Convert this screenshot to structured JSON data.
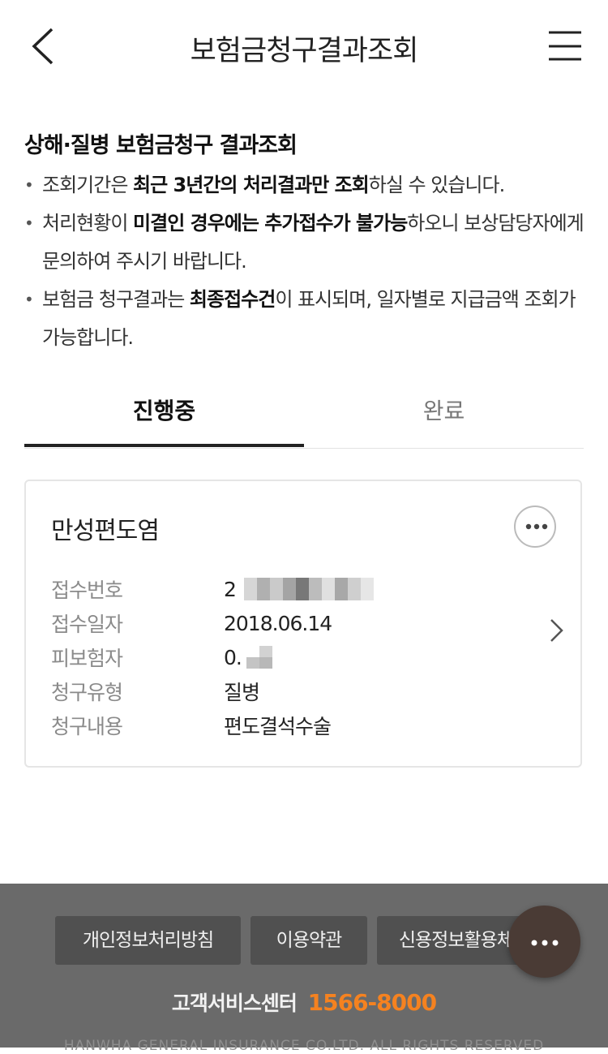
{
  "header": {
    "title": "보험금청구결과조회",
    "back_icon": "chevron-left-icon",
    "menu_icon": "hamburger-menu-icon"
  },
  "section": {
    "title": "상해·질병 보험금청구 결과조회"
  },
  "notices": [
    {
      "pre": "조회기간은 ",
      "bold": "최근 3년간의 처리결과만 조회",
      "post": "하실 수 있습니다."
    },
    {
      "pre": "처리현황이 ",
      "bold": "미결인 경우에는 추가접수가 불가능",
      "post": "하오니 보상담당자에게 문의하여 주시기 바랍니다."
    },
    {
      "pre": "보험금 청구결과는 ",
      "bold": "최종접수건",
      "post": "이 표시되며, 일자별로 지급금액 조회가 가능합니다."
    }
  ],
  "tabs": [
    {
      "label": "진행중",
      "active": true
    },
    {
      "label": "완료",
      "active": false
    }
  ],
  "card": {
    "title": "만성편도염",
    "more_icon": "more-horizontal-icon",
    "rows": [
      {
        "label": "접수번호",
        "value": "2"
      },
      {
        "label": "접수일자",
        "value": "2018.06.14"
      },
      {
        "label": "피보험자",
        "value": "0."
      },
      {
        "label": "청구유형",
        "value": "질병"
      },
      {
        "label": "청구내용",
        "value": "편도결석수술"
      }
    ]
  },
  "footer": {
    "buttons": [
      "개인정보처리방침",
      "이용약관",
      "신용정보활용체계"
    ],
    "cs_label": "고객서비스센터",
    "cs_phone": "1566-8000",
    "copyright": "HANWHA GENERAL INSURANCE CO.LTD. ALL RIGHTS RESERVED"
  },
  "colors": {
    "accent_orange": "#f58220",
    "footer_bg": "#6a6a6a",
    "fab_bg": "#4a3b35"
  }
}
